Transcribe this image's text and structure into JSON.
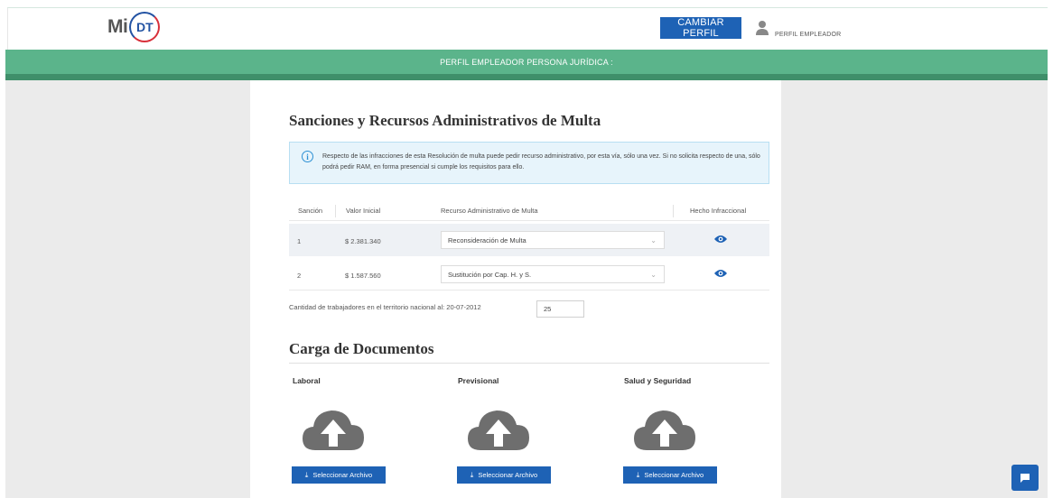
{
  "header": {
    "logo_mi": "Mi",
    "logo_dt": "DT",
    "cambiar_label": "CAMBIAR PERFIL",
    "user_label": "PERFIL EMPLEADOR",
    "banner": "PERFIL EMPLEADOR PERSONA JURÍDICA :"
  },
  "sanciones": {
    "title": "Sanciones y Recursos Administrativos de Multa",
    "alert": "Respecto de las infracciones de esta Resolución de multa puede pedir recurso administrativo, por esta vía, sólo una vez. Si no solicita respecto de una, sólo podrá pedir RAM, en forma presencial si cumple los requisitos para ello.",
    "columns": [
      "Sanción",
      "Valor Inicial",
      "Recurso Administrativo de Multa",
      "Hecho Infraccional"
    ],
    "rows": [
      {
        "sancion": "1",
        "valor": "$ 2.381.340",
        "recurso": "Reconsideración de Multa"
      },
      {
        "sancion": "2",
        "valor": "$ 1.587.560",
        "recurso": "Sustitución por Cap. H. y S."
      }
    ],
    "qty_label": "Cantidad de trabajadores en el territorio nacional al: 20-07-2012",
    "qty_value": "25"
  },
  "carga": {
    "title": "Carga de Documentos",
    "columns": [
      {
        "title": "Laboral",
        "button": "Seleccionar Archivo"
      },
      {
        "title": "Previsional",
        "button": "Seleccionar Archivo"
      },
      {
        "title": "Salud y Seguridad",
        "button": "Seleccionar Archivo"
      }
    ]
  },
  "icons": {
    "info": "info-icon",
    "eye": "eye-icon",
    "cloud": "cloud-upload-icon",
    "chat": "chat-icon",
    "user": "user-icon"
  },
  "colors": {
    "primary": "#1e62b5",
    "banner_green": "#5bb48b",
    "alert_bg": "#e7f4fb"
  }
}
